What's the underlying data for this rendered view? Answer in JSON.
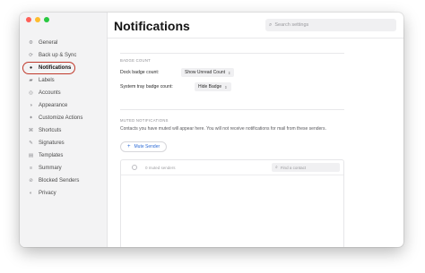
{
  "window": {
    "traffic_lights": [
      "close",
      "minimize",
      "zoom"
    ]
  },
  "sidebar": {
    "items": [
      {
        "label": "General",
        "icon": "gear-icon",
        "glyph": "⚙"
      },
      {
        "label": "Back up & Sync",
        "icon": "sync-icon",
        "glyph": "⟳"
      },
      {
        "label": "Notifications",
        "icon": "bell-icon",
        "glyph": "●",
        "active": true
      },
      {
        "label": "Labels",
        "icon": "label-icon",
        "glyph": "▰"
      },
      {
        "label": "Accounts",
        "icon": "accounts-icon",
        "glyph": "◎"
      },
      {
        "label": "Appearance",
        "icon": "appearance-icon",
        "glyph": "◑"
      },
      {
        "label": "Customize Actions",
        "icon": "customize-icon",
        "glyph": "✦"
      },
      {
        "label": "Shortcuts",
        "icon": "shortcuts-icon",
        "glyph": "⌘"
      },
      {
        "label": "Signatures",
        "icon": "signature-icon",
        "glyph": "✎"
      },
      {
        "label": "Templates",
        "icon": "templates-icon",
        "glyph": "▤"
      },
      {
        "label": "Summary",
        "icon": "summary-icon",
        "glyph": "≡"
      },
      {
        "label": "Blocked Senders",
        "icon": "blocked-icon",
        "glyph": "⊘"
      },
      {
        "label": "Privacy",
        "icon": "privacy-icon",
        "glyph": "◐"
      }
    ]
  },
  "header": {
    "title": "Notifications",
    "search_placeholder": "Search settings"
  },
  "badge": {
    "section_label": "BADGE COUNT",
    "dock_label": "Dock badge count:",
    "dock_value": "Show Unread Count",
    "tray_label": "System tray badge count:",
    "tray_value": "Hide Badge"
  },
  "muted": {
    "section_label": "MUTED NOTIFICATIONS",
    "description": "Contacts you have muted will appear here. You will not receive notifications for mail from these senders.",
    "mute_button": "Mute Sender",
    "count_text": "0 muted senders",
    "find_placeholder": "Find a contact"
  },
  "colors": {
    "accent": "#2d6bd6",
    "highlight_ring": "#c0392b"
  }
}
